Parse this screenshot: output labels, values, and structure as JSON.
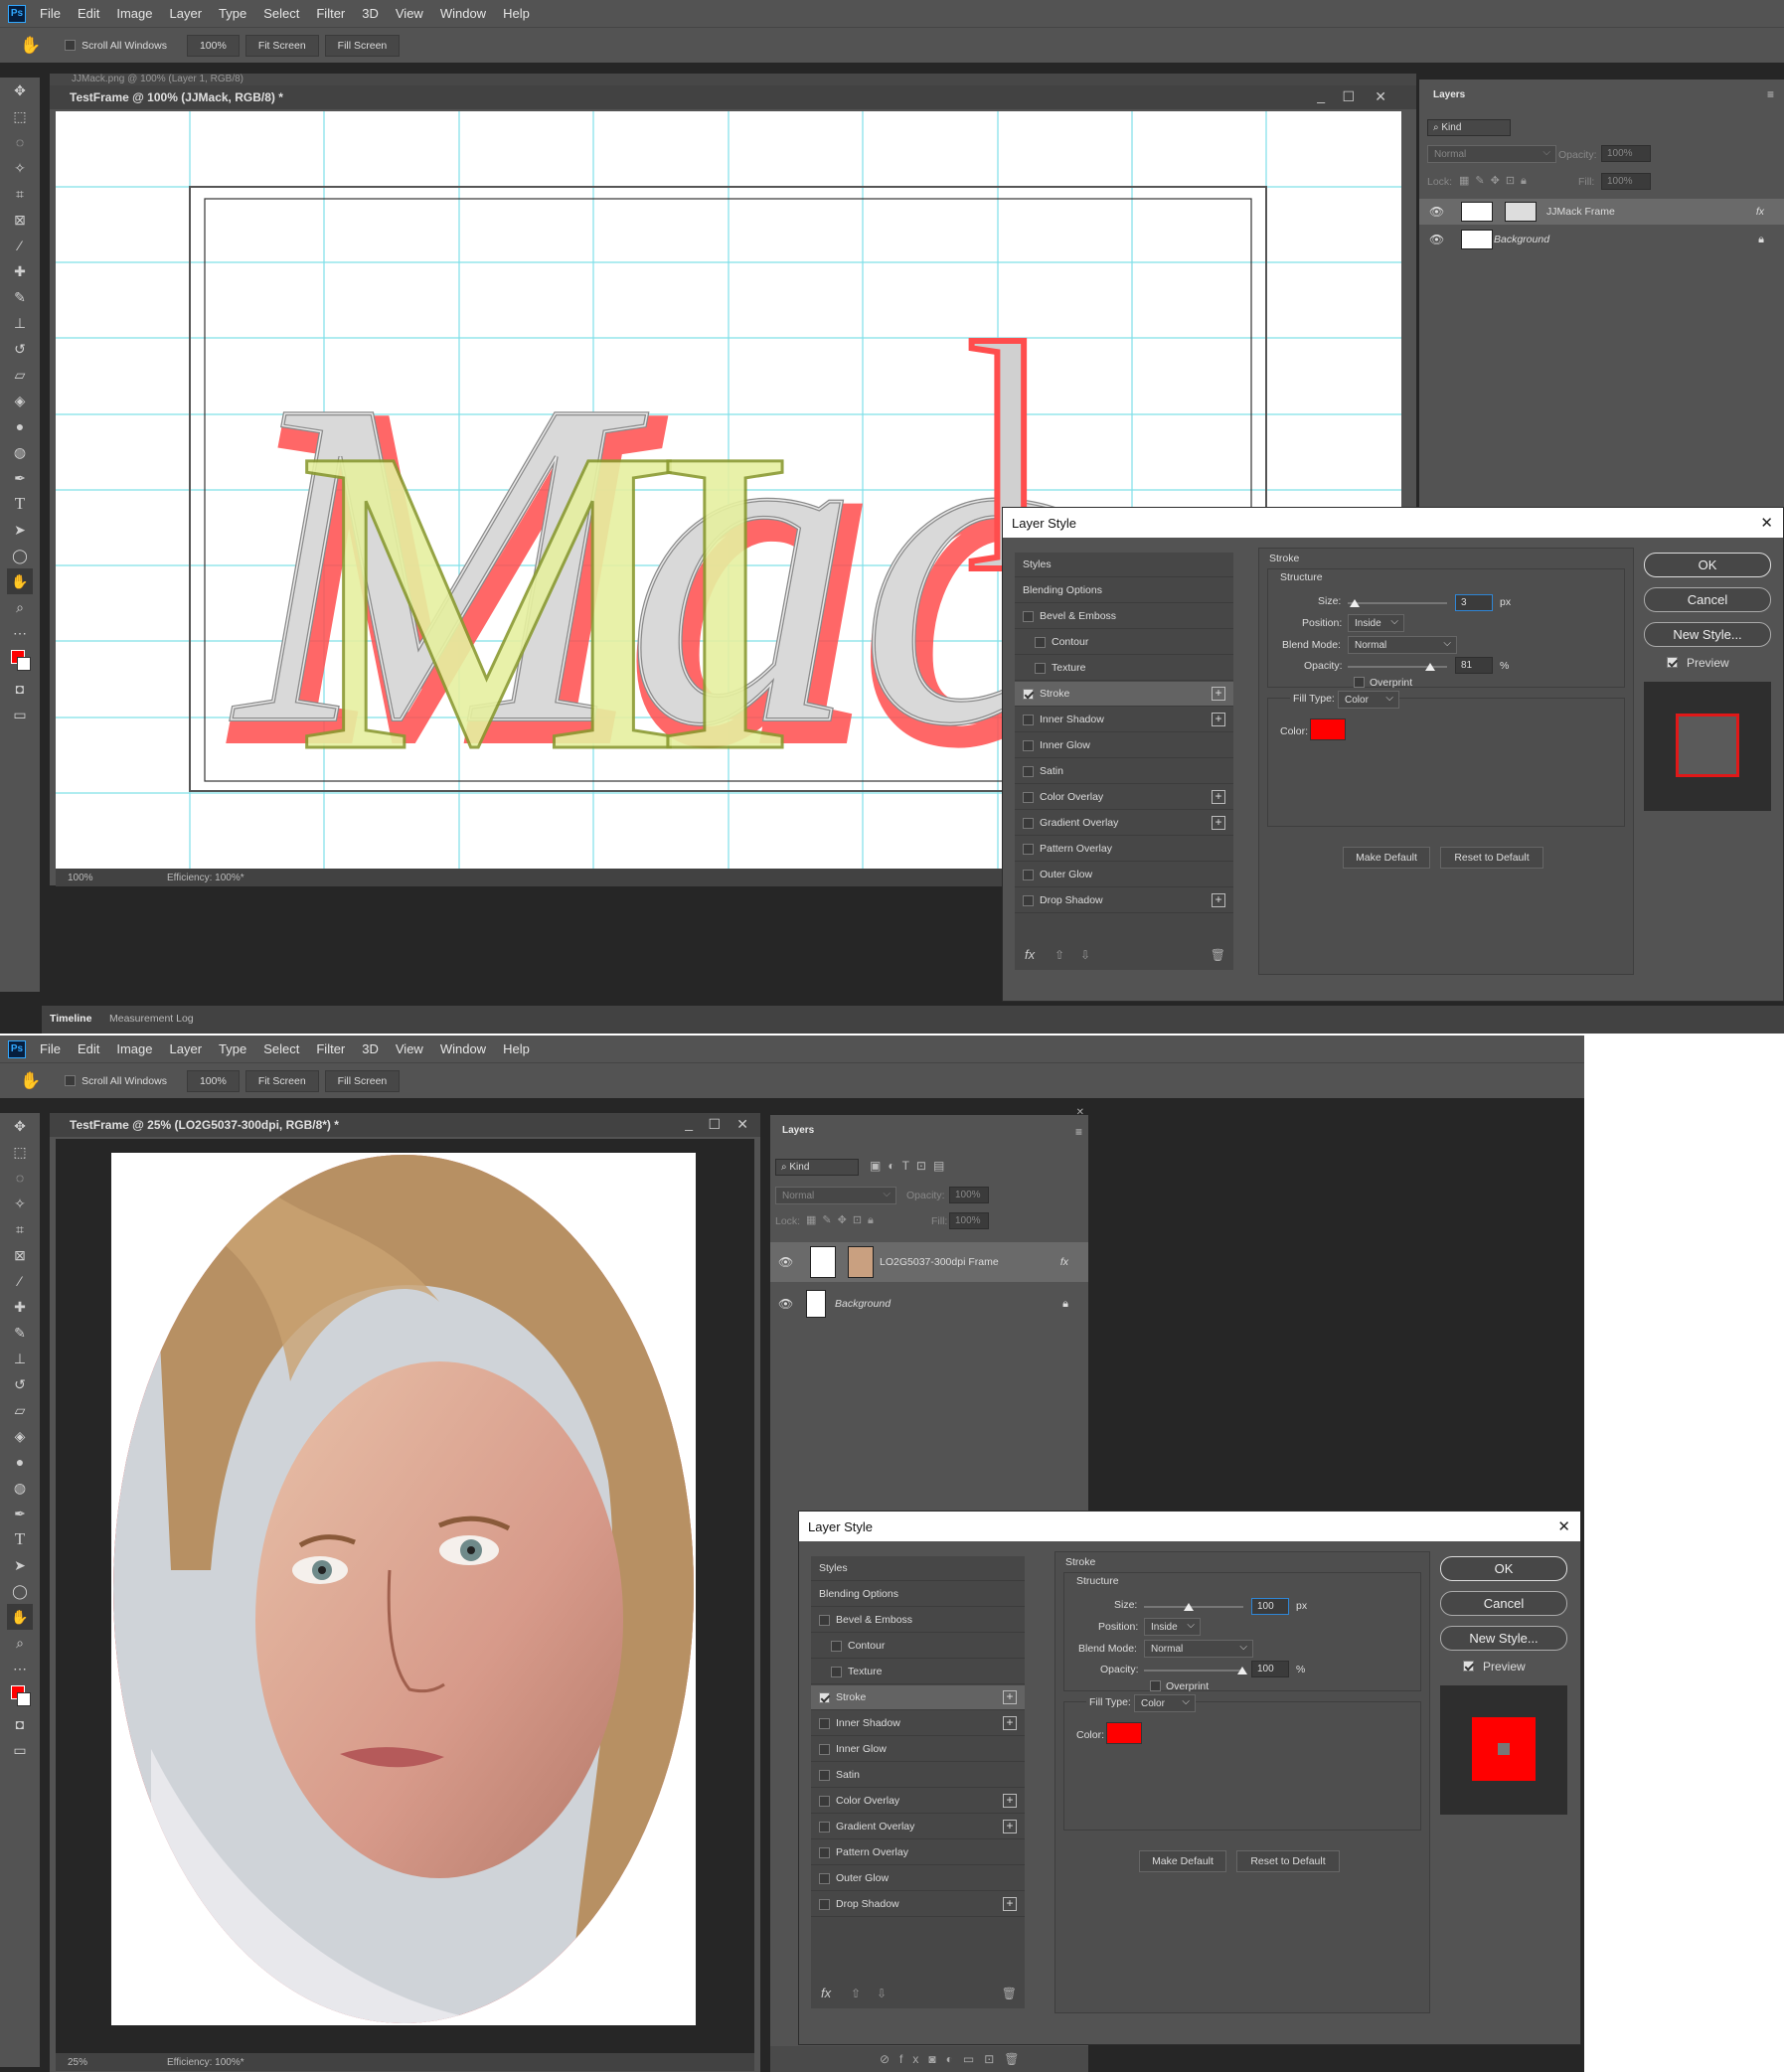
{
  "top": {
    "menu": [
      "File",
      "Edit",
      "Image",
      "Layer",
      "Type",
      "Select",
      "Filter",
      "3D",
      "View",
      "Window",
      "Help"
    ],
    "options": {
      "scroll_all": "Scroll All Windows",
      "zoom": "100%",
      "fit": "Fit Screen",
      "fill": "Fill Screen"
    },
    "back_doc_title": "JJMack.png @ 100% (Layer 1, RGB/8)",
    "doc_title": "TestFrame @ 100% (JJMack, RGB/8) *",
    "status_zoom": "100%",
    "status_eff": "Efficiency: 100%*",
    "bottom_tabs": [
      "Timeline",
      "Measurement Log"
    ],
    "layers": {
      "tab": "Layers",
      "kind": "Kind",
      "blend": "Normal",
      "opacity_label": "Opacity:",
      "opacity": "100%",
      "lock_label": "Lock:",
      "fill_label": "Fill:",
      "fill": "100%",
      "rows": [
        {
          "name": "JJMack Frame",
          "fx": "fx"
        },
        {
          "name": "Background"
        }
      ]
    },
    "dialog": {
      "title": "Layer Style",
      "styles_header": "Styles",
      "items": [
        "Blending Options",
        "Bevel & Emboss",
        "Contour",
        "Texture",
        "Stroke",
        "Inner Shadow",
        "Inner Glow",
        "Satin",
        "Color Overlay",
        "Gradient Overlay",
        "Pattern Overlay",
        "Outer Glow",
        "Drop Shadow"
      ],
      "stroke_title": "Stroke",
      "structure": "Structure",
      "size_label": "Size:",
      "size": "3",
      "px": "px",
      "position_label": "Position:",
      "position": "Inside",
      "blend_label": "Blend Mode:",
      "blend": "Normal",
      "opacity_label": "Opacity:",
      "opacity": "81",
      "pct": "%",
      "overprint": "Overprint",
      "filltype_label": "Fill Type:",
      "filltype": "Color",
      "color_label": "Color:",
      "make_default": "Make Default",
      "reset_default": "Reset to Default",
      "ok": "OK",
      "cancel": "Cancel",
      "new_style": "New Style...",
      "preview": "Preview",
      "fx": "fx"
    }
  },
  "bottom": {
    "menu": [
      "File",
      "Edit",
      "Image",
      "Layer",
      "Type",
      "Select",
      "Filter",
      "3D",
      "View",
      "Window",
      "Help"
    ],
    "options": {
      "scroll_all": "Scroll All Windows",
      "zoom": "100%",
      "fit": "Fit Screen",
      "fill": "Fill Screen"
    },
    "doc_title": "TestFrame @ 25% (LO2G5037-300dpi, RGB/8*) *",
    "status_zoom": "25%",
    "status_eff": "Efficiency: 100%*",
    "layers": {
      "tab": "Layers",
      "kind": "Kind",
      "blend": "Normal",
      "opacity_label": "Opacity:",
      "opacity": "100%",
      "lock_label": "Lock:",
      "fill_label": "Fill:",
      "fill": "100%",
      "rows": [
        {
          "name": "LO2G5037-300dpi Frame",
          "fx": "fx"
        },
        {
          "name": "Background"
        }
      ]
    },
    "dialog": {
      "title": "Layer Style",
      "styles_header": "Styles",
      "items": [
        "Blending Options",
        "Bevel & Emboss",
        "Contour",
        "Texture",
        "Stroke",
        "Inner Shadow",
        "Inner Glow",
        "Satin",
        "Color Overlay",
        "Gradient Overlay",
        "Pattern Overlay",
        "Outer Glow",
        "Drop Shadow"
      ],
      "stroke_title": "Stroke",
      "structure": "Structure",
      "size_label": "Size:",
      "size": "100",
      "px": "px",
      "position_label": "Position:",
      "position": "Inside",
      "blend_label": "Blend Mode:",
      "blend": "Normal",
      "opacity_label": "Opacity:",
      "opacity": "100",
      "pct": "%",
      "overprint": "Overprint",
      "filltype_label": "Fill Type:",
      "filltype": "Color",
      "color_label": "Color:",
      "make_default": "Make Default",
      "reset_default": "Reset to Default",
      "ok": "OK",
      "cancel": "Cancel",
      "new_style": "New Style...",
      "preview": "Preview",
      "fx": "fx"
    }
  },
  "colors": {
    "stroke": "#ff0000",
    "ui_bg": "#535353",
    "workspace": "#262626",
    "guide": "#7fe0e8"
  },
  "icons": [
    "hand-tool-icon",
    "move-tool-icon",
    "marquee-icon",
    "lasso-icon",
    "magic-wand-icon",
    "crop-icon",
    "frame-icon",
    "eyedropper-icon",
    "healing-icon",
    "brush-icon",
    "stamp-icon",
    "history-brush-icon",
    "eraser-icon",
    "bucket-icon",
    "blur-icon",
    "dodge-icon",
    "pen-icon",
    "type-icon",
    "path-select-icon",
    "ellipse-icon",
    "zoom-icon",
    "eye-icon",
    "lock-icon",
    "close-icon",
    "trash-icon"
  ]
}
